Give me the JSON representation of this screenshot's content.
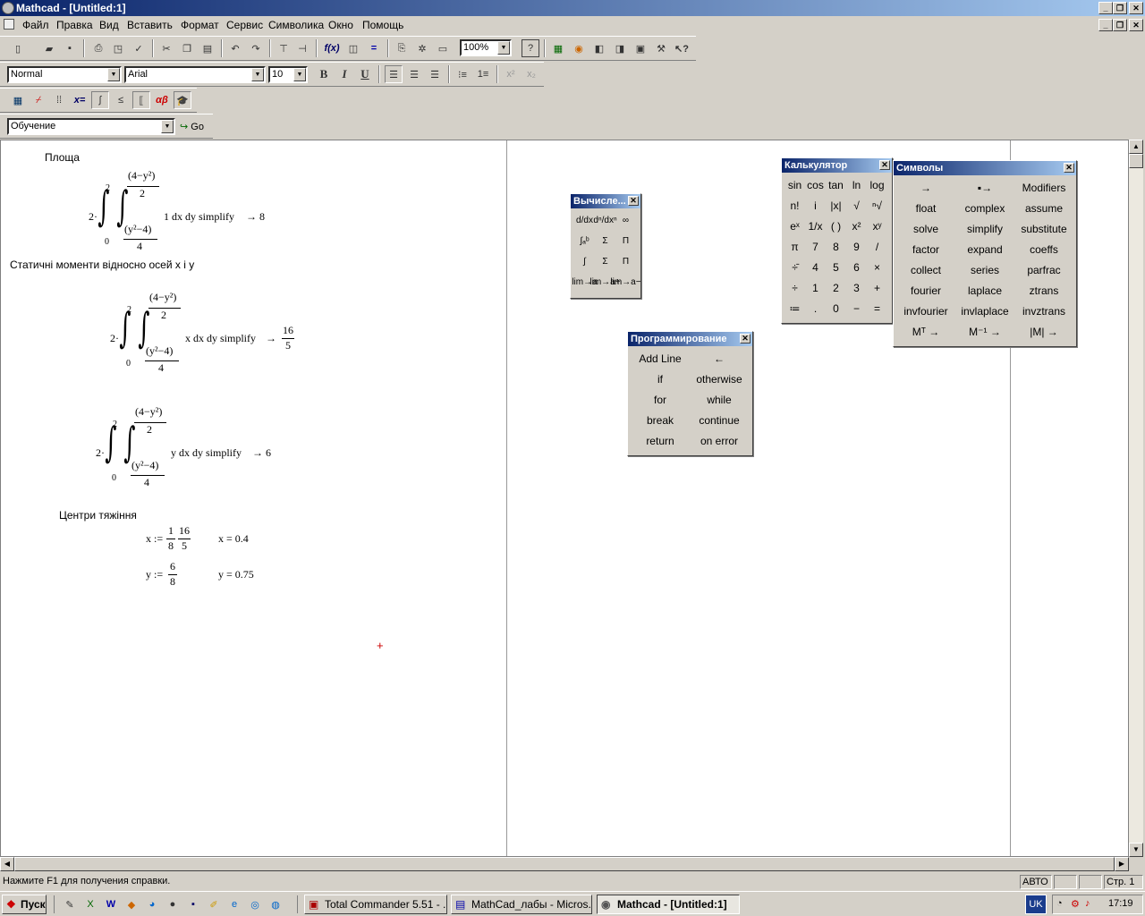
{
  "window": {
    "title": "Mathcad - [Untitled:1]",
    "min": "_",
    "max": "❐",
    "close": "✕"
  },
  "menu": [
    "Файл",
    "Правка",
    "Вид",
    "Вставить",
    "Формат",
    "Сервис",
    "Символика",
    "Окно",
    "Помощь"
  ],
  "toolbar": {
    "zoom": "100%"
  },
  "format": {
    "style": "Normal",
    "font": "Arial",
    "size": "10",
    "bold": "B",
    "italic": "I",
    "underline": "U"
  },
  "resources": {
    "value": "Обучение",
    "go": "Go"
  },
  "doc": {
    "h_area": "Площа",
    "h_moments": "Статичні моменти відносно осей x і y",
    "h_centers": "Центри тяжіння",
    "eq1": {
      "coef": "2·",
      "lower": "0",
      "upper": "2",
      "inner_upper_num": "(4−y²)",
      "inner_upper_den": "2",
      "inner_lower_num": "(y²−4)",
      "inner_lower_den": "4",
      "integrand": "1 dx dy  simplify",
      "arrow": "→",
      "result": "8"
    },
    "eq2": {
      "coef": "2·",
      "lower": "0",
      "upper": "2",
      "inner_upper_num": "(4−y²)",
      "inner_upper_den": "2",
      "inner_lower_num": "(y²−4)",
      "inner_lower_den": "4",
      "integrand": "x dx dy  simplify",
      "arrow": "→",
      "result_num": "16",
      "result_den": "5"
    },
    "eq3": {
      "coef": "2·",
      "lower": "0",
      "upper": "2",
      "inner_upper_num": "(4−y²)",
      "inner_upper_den": "2",
      "inner_lower_num": "(y²−4)",
      "inner_lower_den": "4",
      "integrand": "y dx dy  simplify",
      "arrow": "→",
      "result": "6"
    },
    "xdef": {
      "lhs": "x :=",
      "f1n": "1",
      "f1d": "8",
      "f2n": "16",
      "f2d": "5",
      "eval": "x = 0.4"
    },
    "ydef": {
      "lhs": "y :=",
      "fn": "6",
      "fd": "8",
      "eval": "y = 0.75"
    }
  },
  "calculus_panel": {
    "title": "Вычисле...",
    "cells": [
      "d/dx",
      "dⁿ/dxⁿ",
      "∞",
      "∫ₐᵇ",
      "Σ",
      "Π",
      "∫",
      "Σ",
      "Π",
      "lim→a",
      "lim→a+",
      "lim→a−"
    ]
  },
  "calculator_panel": {
    "title": "Калькулятор",
    "cells": [
      "sin",
      "cos",
      "tan",
      "ln",
      "log",
      "n!",
      "i",
      "|x|",
      "√",
      "ⁿ√",
      "eˣ",
      "1/x",
      "( )",
      "x²",
      "xʸ",
      "π",
      "7",
      "8",
      "9",
      "/",
      "÷̄",
      "4",
      "5",
      "6",
      "×",
      "÷",
      "1",
      "2",
      "3",
      "+",
      "≔",
      ".",
      "0",
      "−",
      "="
    ]
  },
  "symbols_panel": {
    "title": "Символы",
    "cells": [
      "→",
      "▪→",
      "Modifiers",
      "float",
      "complex",
      "assume",
      "solve",
      "simplify",
      "substitute",
      "factor",
      "expand",
      "coeffs",
      "collect",
      "series",
      "parfrac",
      "fourier",
      "laplace",
      "ztrans",
      "invfourier",
      "invlaplace",
      "invztrans",
      "Mᵀ →",
      "M⁻¹ →",
      "|M| →"
    ]
  },
  "programming_panel": {
    "title": "Программирование",
    "cells": [
      "Add Line",
      "←",
      "if",
      "otherwise",
      "for",
      "while",
      "break",
      "continue",
      "return",
      "on error"
    ]
  },
  "status": {
    "help": "Нажмите F1 для получения справки.",
    "mode": "АВТО",
    "page": "Стр. 1"
  },
  "taskbar": {
    "start": "Пуск",
    "tasks": [
      "Total Commander 5.51 - ...",
      "MathCad_лабы - Micros...",
      "Mathcad - [Untitled:1]"
    ],
    "lang": "UK",
    "clock": "17:19"
  }
}
